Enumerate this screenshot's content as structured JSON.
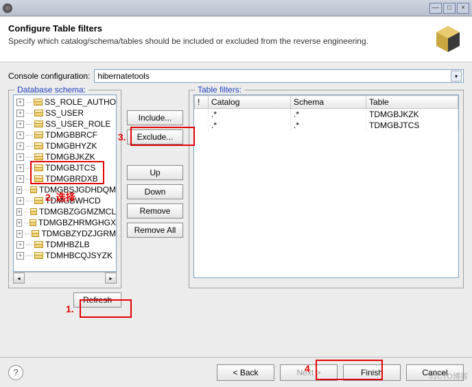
{
  "window": {
    "minimize": "—",
    "maximize": "□",
    "close": "×"
  },
  "header": {
    "title": "Configure Table filters",
    "subtitle": "Specify which catalog/schema/tables should be included or excluded from the reverse engineering."
  },
  "config": {
    "label": "Console configuration:",
    "value": "hibernatetools"
  },
  "db_schema": {
    "legend": "Database schema:",
    "items": [
      "SS_ROLE_AUTHO",
      "SS_USER",
      "SS_USER_ROLE",
      "TDMGBBRCF",
      "TDMGBHYZK",
      "TDMGBJKZK",
      "TDMGBJTCS",
      "TDMGBRDXB",
      "TDMGBSJGDHDQM",
      "TDMGBWHCD",
      "TDMGBZGGMZMCL",
      "TDMGBZHRMGHGX",
      "TDMGBZYDZJGRM",
      "TDMHBZLB",
      "TDMHBCQJSYZK"
    ],
    "refresh": "Refresh"
  },
  "mid_buttons": {
    "include": "Include...",
    "exclude": "Exclude...",
    "up": "Up",
    "down": "Down",
    "remove": "Remove",
    "remove_all": "Remove All"
  },
  "filters": {
    "legend": "Table filters:",
    "headers": {
      "bang": "!",
      "catalog": "Catalog",
      "schema": "Schema",
      "table": "Table"
    },
    "rows": [
      {
        "catalog": ".*",
        "schema": ".*",
        "table": "TDMGBJKZK"
      },
      {
        "catalog": ".*",
        "schema": ".*",
        "table": "TDMGBJTCS"
      }
    ]
  },
  "nav": {
    "back": "< Back",
    "next": "Next >",
    "finish": "Finish",
    "cancel": "Cancel"
  },
  "annotations": {
    "a1": "1.",
    "a2": "2. 选择",
    "a3": "3.",
    "a4": "4"
  },
  "watermark": "51CTO博客"
}
